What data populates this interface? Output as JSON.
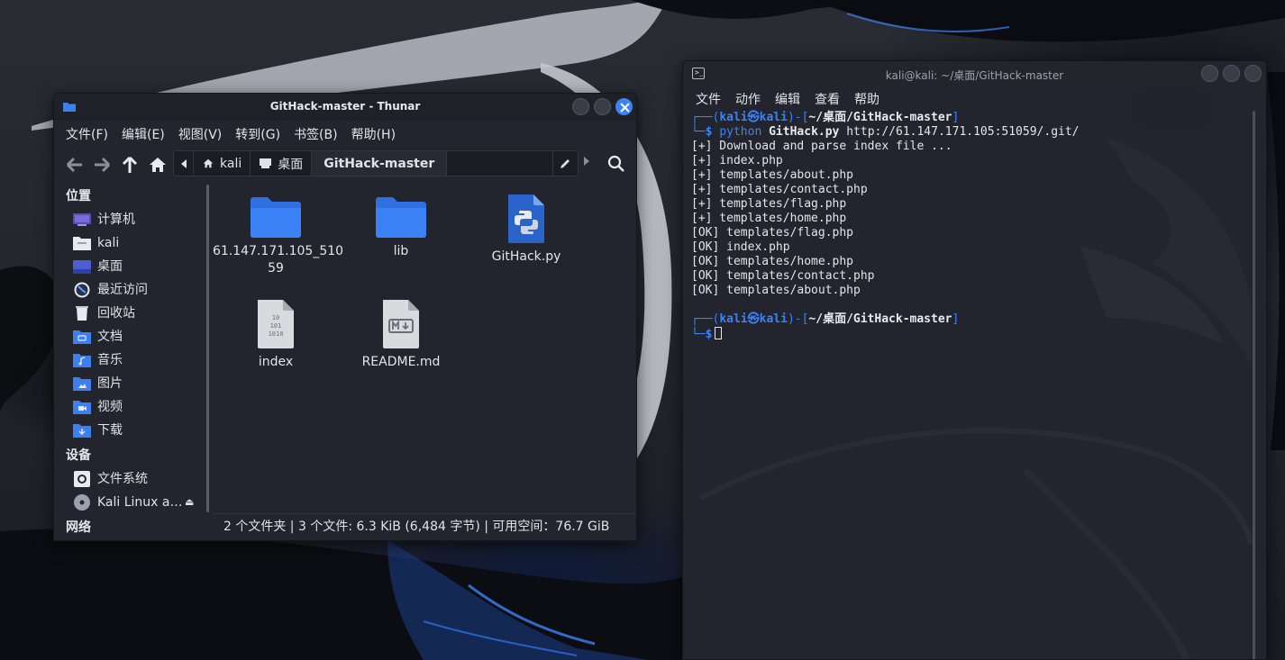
{
  "thunar": {
    "title": "GitHack-master - Thunar",
    "menu": [
      "文件(F)",
      "编辑(E)",
      "视图(V)",
      "转到(G)",
      "书签(B)",
      "帮助(H)"
    ],
    "path": {
      "home": "kali",
      "desktop": "桌面",
      "current": "GitHack-master"
    },
    "sidebar": {
      "places_header": "位置",
      "places": [
        {
          "label": "计算机",
          "icon": "computer-icon"
        },
        {
          "label": "kali",
          "icon": "home-folder-icon"
        },
        {
          "label": "桌面",
          "icon": "desktop-folder-icon"
        },
        {
          "label": "最近访问",
          "icon": "recent-icon"
        },
        {
          "label": "回收站",
          "icon": "trash-icon"
        },
        {
          "label": "文档",
          "icon": "documents-folder-icon"
        },
        {
          "label": "音乐",
          "icon": "music-folder-icon"
        },
        {
          "label": "图片",
          "icon": "pictures-folder-icon"
        },
        {
          "label": "视频",
          "icon": "videos-folder-icon"
        },
        {
          "label": "下载",
          "icon": "downloads-folder-icon"
        }
      ],
      "devices_header": "设备",
      "devices": [
        {
          "label": "文件系统",
          "icon": "filesystem-icon"
        },
        {
          "label": "Kali Linux a…",
          "icon": "cdrom-icon"
        }
      ],
      "network_header": "网络"
    },
    "files": [
      {
        "name": "61.147.171.105_51059",
        "line1": "61.147.171.105_510",
        "line2": "59",
        "icon": "folder-icon"
      },
      {
        "name": "lib",
        "line1": "lib",
        "line2": "",
        "icon": "folder-icon"
      },
      {
        "name": "GitHack.py",
        "line1": "GitHack.py",
        "line2": "",
        "icon": "python-file-icon"
      },
      {
        "name": "index",
        "line1": "index",
        "line2": "",
        "icon": "binary-file-icon"
      },
      {
        "name": "README.md",
        "line1": "README.md",
        "line2": "",
        "icon": "markdown-file-icon"
      }
    ],
    "status": "2 个文件夹 | 3 个文件: 6.3 KiB (6,484 字节) | 可用空间：76.7 GiB"
  },
  "terminal": {
    "title": "kali@kali: ~/桌面/GitHack-master",
    "menu": [
      "文件",
      "动作",
      "编辑",
      "查看",
      "帮助"
    ],
    "prompt": {
      "top_open": "┌──(",
      "user_host": "kali㉿kali",
      "top_mid": ")-[",
      "cwd": "~/桌面/GitHack-master",
      "top_close": "]",
      "bottom": "└─",
      "dollar": "$"
    },
    "command": {
      "cmd": "python",
      "script": "GitHack.py",
      "arg": "http://61.147.171.105:51059/.git/"
    },
    "output": [
      "[+] Download and parse index file ...",
      "[+] index.php",
      "[+] templates/about.php",
      "[+] templates/contact.php",
      "[+] templates/flag.php",
      "[+] templates/home.php",
      "[OK] templates/flag.php",
      "[OK] index.php",
      "[OK] templates/home.php",
      "[OK] templates/contact.php",
      "[OK] templates/about.php"
    ]
  },
  "colors": {
    "accent": "#3b82f6",
    "window_bg": "#23252e",
    "folder": "#3b7ff0"
  }
}
